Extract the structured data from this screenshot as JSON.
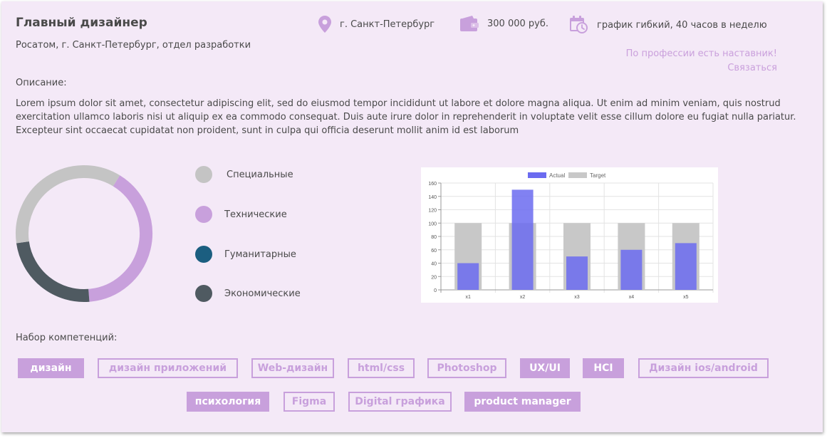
{
  "job": {
    "title": "Главный дизайнер",
    "company": "Росатом, г. Санкт-Петербург, отдел разработки"
  },
  "meta": {
    "location": "г. Санкт-Петербург",
    "salary": "300 000 руб.",
    "schedule": "график гибкий, 40 часов в неделю",
    "location_icon": "location-pin-icon",
    "salary_icon": "wallet-icon",
    "schedule_icon": "calendar-clock-icon"
  },
  "mentor": {
    "text": "По профессии есть наставник!",
    "link": "Связаться"
  },
  "description": {
    "label": "Описание:",
    "text": "Lorem ipsum dolor sit amet, consectetur adipiscing elit, sed do eiusmod tempor incididunt ut labore et dolore magna aliqua. Ut enim ad minim veniam, quis nostrud exercitation ullamco laboris nisi ut aliquip ex ea commodo consequat. Duis aute irure dolor in reprehenderit in voluptate velit esse cillum dolore eu fugiat nulla pariatur. Excepteur sint occaecat cupidatat non proident, sunt in culpa qui officia deserunt mollit anim id est laborum"
  },
  "competency_legend": [
    {
      "label": "Специальные",
      "color": "#c4c4c4"
    },
    {
      "label": "Технические",
      "color": "#c8a0dc"
    },
    {
      "label": "Гуманитарные",
      "color": "#1b5e80"
    },
    {
      "label": "Экономические",
      "color": "#4f5a61"
    }
  ],
  "donut_segments": [
    {
      "label": "Технические",
      "value": 0.4,
      "color": "#c8a0dc"
    },
    {
      "label": "Экономические",
      "value": 0.24,
      "color": "#4f5a61"
    },
    {
      "label": "Специальные",
      "value": 0.36,
      "color": "#c4c4c4"
    }
  ],
  "chart_data": {
    "type": "bar",
    "categories": [
      "x1",
      "x2",
      "x3",
      "x4",
      "x5"
    ],
    "series": [
      {
        "name": "Actual",
        "values": [
          40,
          150,
          50,
          60,
          70
        ],
        "color": "#6b6bf0"
      },
      {
        "name": "Target",
        "values": [
          100,
          100,
          100,
          100,
          100
        ],
        "color": "#c8c8c8"
      }
    ],
    "ylim": [
      0,
      160
    ],
    "yticks": [
      0,
      20,
      40,
      60,
      80,
      100,
      120,
      140,
      160
    ],
    "legend_position": "top",
    "grid": true,
    "title": "",
    "xlabel": "",
    "ylabel": ""
  },
  "skills": {
    "label": "Набор компетенций:",
    "tags": [
      {
        "label": "дизайн",
        "style": "filled"
      },
      {
        "label": "дизайн приложений",
        "style": "outline"
      },
      {
        "label": "Web-дизайн",
        "style": "outline"
      },
      {
        "label": "html/css",
        "style": "outline"
      },
      {
        "label": "Photoshop",
        "style": "outline"
      },
      {
        "label": "UX/UI",
        "style": "filled"
      },
      {
        "label": "HCI",
        "style": "filled"
      },
      {
        "label": "Дизайн ios/android",
        "style": "outline"
      },
      {
        "label": "психология",
        "style": "filled"
      },
      {
        "label": "Figma",
        "style": "outline"
      },
      {
        "label": "Digital графика",
        "style": "outline"
      },
      {
        "label": "product manager",
        "style": "filled"
      }
    ]
  },
  "colors": {
    "accent": "#c8a0dc",
    "background": "#f4e9f7",
    "text": "#4a4a4a"
  }
}
